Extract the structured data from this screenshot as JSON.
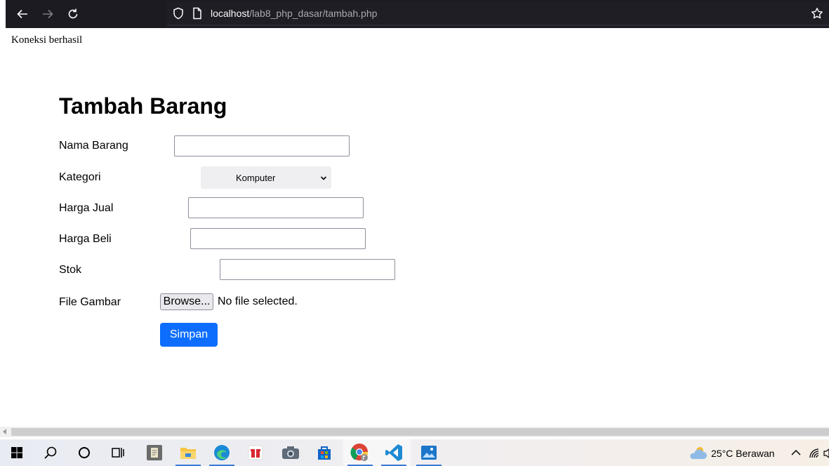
{
  "browser": {
    "url_host": "localhost",
    "url_path": "/lab8_php_dasar/tambah.php"
  },
  "page": {
    "connection_status": "Koneksi berhasil",
    "title": "Tambah Barang",
    "form": {
      "nama_label": "Nama Barang",
      "nama_value": "",
      "kategori_label": "Kategori",
      "kategori_selected": "Komputer",
      "harga_jual_label": "Harga Jual",
      "harga_jual_value": "",
      "harga_beli_label": "Harga Beli",
      "harga_beli_value": "",
      "stok_label": "Stok",
      "stok_value": "",
      "file_label": "File Gambar",
      "browse_label": "Browse...",
      "file_status": "No file selected.",
      "submit_label": "Simpan"
    }
  },
  "taskbar": {
    "icons": [
      "windows-start-icon",
      "search-icon",
      "cortana-icon",
      "task-view-icon",
      "notepad-icon",
      "file-explorer-icon",
      "edge-icon",
      "gift-icon",
      "camera-icon",
      "store-icon",
      "chrome-icon",
      "vscode-icon",
      "photos-icon"
    ],
    "weather": "25°C  Berawan"
  },
  "colors": {
    "toolbar_bg": "#1c1b22",
    "submit_bg": "#0d6efd"
  }
}
